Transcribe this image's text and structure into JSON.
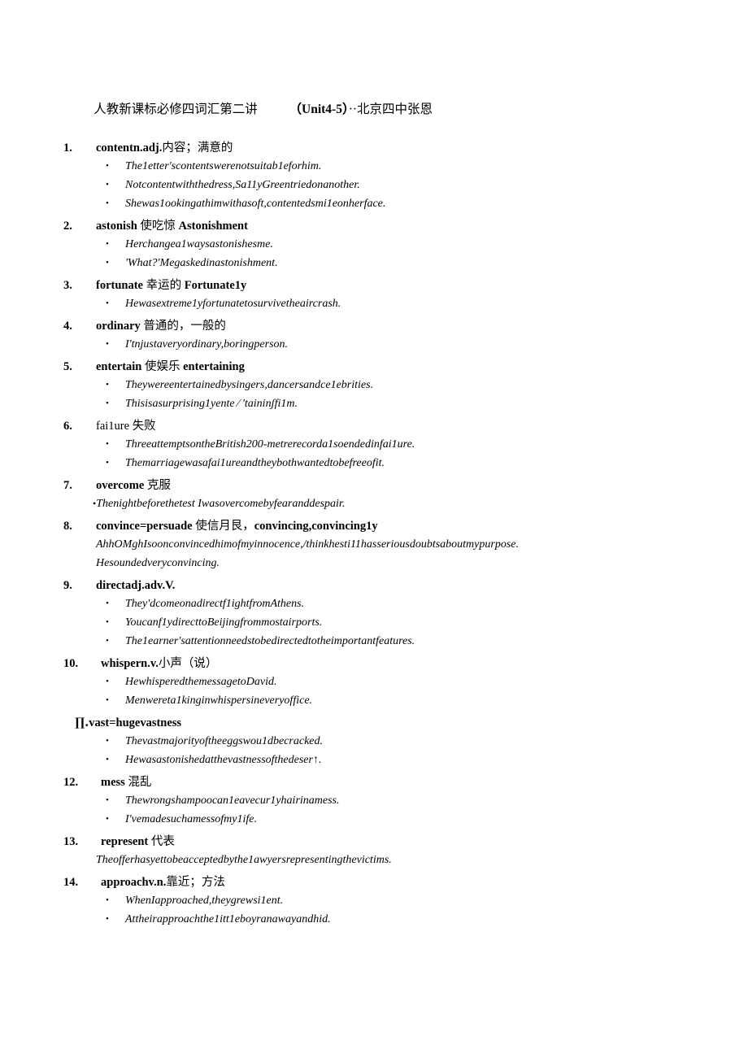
{
  "document": {
    "header": {
      "title": "人教新课标必修四词汇第二讲",
      "unit": "（Unit4-5）",
      "author": "··北京四中张恩"
    },
    "entries": [
      {
        "num": "1.",
        "word": "contentn.adj.",
        "gloss": "内容；满意的",
        "deriv": "",
        "bold_word": true,
        "examples": [
          "The1etter'scontentswerenotsuitab1eforhim.",
          "Notcontentwiththedress,Sa11yGreentriedonanother.",
          "Shewas1ookingathimwithasoft,contentedsmi1eonherface."
        ]
      },
      {
        "num": "2.",
        "word": "astonish ",
        "gloss": "使吃惊 ",
        "deriv": "Astonishment",
        "bold_word": true,
        "examples": [
          "Herchangea1waysastonishesme.",
          "'What?'Megaskedinastonishment."
        ]
      },
      {
        "num": "3.",
        "word": "fortunate ",
        "gloss": "幸运的 ",
        "deriv": "Fortunate1y",
        "bold_word": true,
        "examples": [
          "Hewasextreme1yfortunatetosurvivetheaircrash."
        ]
      },
      {
        "num": "4.",
        "word": "ordinary ",
        "gloss": "普通的，一般的",
        "deriv": "",
        "bold_word": true,
        "examples": [
          "I'tnjustaveryordinary,boringperson."
        ]
      },
      {
        "num": "5.",
        "word": "entertain ",
        "gloss": "使娱乐 ",
        "deriv": "entertaining",
        "bold_word": true,
        "examples": [
          "Theywereentertainedbysingers,dancersandce1ebrities.",
          "Thisisasurprising1yente ∕ 'taininʃfi1m."
        ]
      },
      {
        "num": "6.",
        "word": "fai1ure ",
        "gloss": "失败",
        "deriv": "",
        "bold_word": false,
        "examples": [
          "ThreeattemptsontheBritish200-metrerecorda1soendedinfai1ure.",
          "Themarriagewasafai1ureandtheybothwantedtobefreeofit."
        ]
      },
      {
        "num": "7.",
        "word": "overcome ",
        "gloss": "克服",
        "deriv": "",
        "bold_word": true,
        "tight_bullets": true,
        "examples": [
          "Thenightbeforethetest Iwasovercomebyfearanddespair."
        ]
      },
      {
        "num": "8.",
        "word": "convince=persuade ",
        "gloss": "使信月艮，",
        "deriv": "convincing,convincing1y",
        "bold_word": true,
        "paragraphs": [
          "AhhOMghIsoonconvincedhimofmyinnocence,/thinkhesti11hasseriousdoubtsaboutmypurpose.",
          "Hesoundedveryconvincing."
        ],
        "examples": []
      },
      {
        "num": "9.",
        "word": "directadj.adv.V.",
        "gloss": "",
        "deriv": "",
        "bold_word": true,
        "examples": [
          "They'dcomeonadirectf1ightfromAthens.",
          "Youcanf1ydirecttoBeijingfrommostairports.",
          "The1earner'sattentionneedstobedirectedtotheimportantfeatures."
        ]
      },
      {
        "num": "10.",
        "word": "whispern.v.",
        "gloss": "小声（说）",
        "deriv": "",
        "bold_word": true,
        "wide_num": true,
        "examples": [
          "HewhisperedthemessagetoDavid.",
          "Menwereta1kinginwhispersineveryoffice."
        ]
      },
      {
        "num": "∏.",
        "word": "vast=hugevastness",
        "gloss": "",
        "deriv": "",
        "bold_word": true,
        "flush": true,
        "examples": [
          "Thevastmajorityoftheeggswou1dbecracked.",
          "Hewasastonishedatthevastnessofthedeser↑."
        ]
      },
      {
        "num": "12.",
        "word": "mess ",
        "gloss": "混乱",
        "deriv": "",
        "bold_word": true,
        "wide_num": true,
        "examples": [
          "Thewrongshampoocan1eavecur1yhairinamess.",
          "I'vemadesuchamessofmy1ife."
        ]
      },
      {
        "num": "13.",
        "word": "represent ",
        "gloss": "代表",
        "deriv": "",
        "bold_word": true,
        "wide_num": true,
        "paragraphs": [
          "Theofferhasyettobeacceptedbythe1awyersrepresentingthevictims."
        ],
        "examples": []
      },
      {
        "num": "14.",
        "word": "approachv.n.",
        "gloss": "靠近；方法",
        "deriv": "",
        "bold_word": true,
        "wide_num": true,
        "examples": [
          "WhenIapproached,theygrewsi1ent.",
          "Attheirapproachthe1itt1eboyranawayandhid."
        ]
      }
    ],
    "bullet_glyph": "•"
  }
}
